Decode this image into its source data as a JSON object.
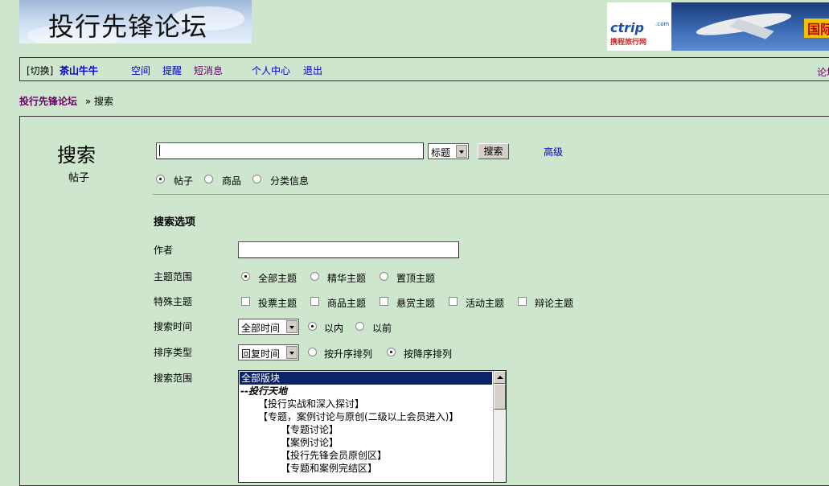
{
  "header": {
    "logo_title": "投行先锋论坛",
    "ad": {
      "brand": "ctrip",
      "brand_suffix": ".com",
      "brand_cn": "携程旅行网",
      "tagline": "国际"
    }
  },
  "nav": {
    "switch_label": "[切换]",
    "username": "茶山牛牛",
    "links": [
      "空间",
      "提醒",
      "短消息",
      "个人中心",
      "退出"
    ],
    "right_link": "论坛"
  },
  "breadcrumb": {
    "home": "投行先锋论坛",
    "sep": "»",
    "current": "搜索"
  },
  "search": {
    "heading": "搜索",
    "subheading": "帖子",
    "query_value": "",
    "scope_select": "标题",
    "submit_label": "搜索",
    "advanced_label": "高级",
    "types": [
      {
        "label": "帖子",
        "checked": true
      },
      {
        "label": "商品",
        "checked": false
      },
      {
        "label": "分类信息",
        "checked": false
      }
    ]
  },
  "options": {
    "section_title": "搜索选项",
    "author_label": "作者",
    "author_value": "",
    "topic_range_label": "主题范围",
    "topic_range": [
      {
        "label": "全部主题",
        "checked": true
      },
      {
        "label": "精华主题",
        "checked": false
      },
      {
        "label": "置顶主题",
        "checked": false
      }
    ],
    "special_label": "特殊主题",
    "special": [
      "投票主题",
      "商品主题",
      "悬赏主题",
      "活动主题",
      "辩论主题"
    ],
    "time_label": "搜索时间",
    "time_select": "全部时间",
    "time_dir": [
      {
        "label": "以内",
        "checked": true
      },
      {
        "label": "以前",
        "checked": false
      }
    ],
    "sort_label": "排序类型",
    "sort_select": "回复时间",
    "sort_dir": [
      {
        "label": "按升序排列",
        "checked": false
      },
      {
        "label": "按降序排列",
        "checked": true
      }
    ],
    "range_label": "搜索范围",
    "forums": [
      "全部版块",
      "--投行天地",
      "【投行实战和深入探讨】",
      "【专题，案例讨论与原创(二级以上会员进入)】",
      "【专题讨论】",
      "【案例讨论】",
      "【投行先锋会员原创区】",
      "【专题和案例完结区】"
    ]
  },
  "colors": {
    "bg": "#cde6cd",
    "link": "#0000cc",
    "visited": "#660066",
    "selection": "#0a246a"
  }
}
